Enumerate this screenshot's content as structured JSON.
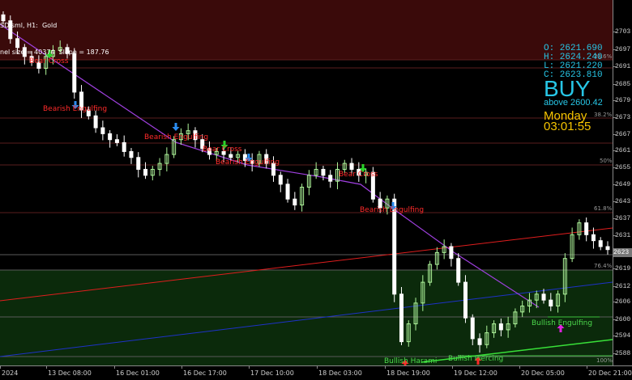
{
  "header": {
    "line1": "SD.sml, H1:  Gold",
    "line2": "nel size = 40374  Slope = 187.76"
  },
  "price_axis": {
    "ticks": [
      "2703",
      "2697",
      "2691",
      "2685",
      "2679",
      "2673",
      "2667",
      "2661",
      "2655",
      "2649",
      "2643",
      "2637",
      "2631",
      "2625",
      "2619",
      "2612",
      "2606",
      "2600",
      "2594",
      "2588"
    ],
    "current_price": "2623"
  },
  "time_axis": {
    "ticks": [
      "2024",
      "13 Dec 08:00",
      "16 Dec 01:00",
      "16 Dec 17:00",
      "17 Dec 10:00",
      "18 Dec 03:00",
      "18 Dec 19:00",
      "19 Dec 12:00",
      "20 Dec 05:00",
      "20 Dec 21:00"
    ]
  },
  "fib_levels": [
    "23.6%",
    "38.2%",
    "50%",
    "61.8%",
    "76.4%",
    "100%"
  ],
  "info_panel": {
    "open": "O: 2621.690",
    "high": "H: 2624.240",
    "low": "L: 2621.220",
    "close": "C: 2623.810",
    "signal": "BUY",
    "signal_sub": "above 2600.42",
    "day": "Monday",
    "clock": "03:01:55"
  },
  "patterns": [
    {
      "text": "Bear Cross",
      "color": "#ff2a2a",
      "arrow": "green-down"
    },
    {
      "text": "Bearish Engulfing",
      "color": "#ff2a2a",
      "arrow": "blue-down"
    },
    {
      "text": "Bearish Engulfing",
      "color": "#ff2a2a",
      "arrow": "blue-down"
    },
    {
      "text": "Bear Cross",
      "color": "#ff2a2a",
      "arrow": "green-down"
    },
    {
      "text": "Bearish Engulfing",
      "color": "#ff2a2a",
      "arrow": "blue-down"
    },
    {
      "text": "Bear Cross",
      "color": "#ff2a2a",
      "arrow": "green-down"
    },
    {
      "text": "Bearish Engulfing",
      "color": "#ff2a2a",
      "arrow": "blue-down"
    },
    {
      "text": "Bullish Harami",
      "color": "#4cd94c",
      "arrow": "red-up"
    },
    {
      "text": "Bullish Piercing",
      "color": "#4cd94c",
      "arrow": "red-up"
    },
    {
      "text": "Bullish Engulfing",
      "color": "#4cd94c",
      "arrow": "magenta-up"
    }
  ],
  "colors": {
    "supply_zone": "#3a0a0a",
    "demand_zone": "#0b2a0b",
    "bull_candle": "#aef59a",
    "bear_candle": "#ffffff",
    "downtrend": "#a040e0",
    "channel_upper": "#e01e1e",
    "channel_lower": "#1e32c8",
    "support_trend": "#38e038"
  },
  "chart_data": {
    "type": "candlestick",
    "symbol": "Gold",
    "timeframe": "H1",
    "ylim": [
      2584,
      2707
    ],
    "close_series_approx": [
      2700,
      2694,
      2691,
      2688,
      2686,
      2684,
      2688,
      2690,
      2691,
      2689,
      2676,
      2670,
      2668,
      2664,
      2662,
      2660,
      2659,
      2656,
      2654,
      2650,
      2648,
      2650,
      2652,
      2655,
      2660,
      2662,
      2663,
      2660,
      2657,
      2655,
      2656,
      2655,
      2654,
      2655,
      2653,
      2652,
      2655,
      2652,
      2648,
      2645,
      2640,
      2638,
      2644,
      2648,
      2650,
      2648,
      2646,
      2650,
      2652,
      2650,
      2648,
      2649,
      2640,
      2637,
      2640,
      2608,
      2592,
      2598,
      2605,
      2612,
      2618,
      2622,
      2624,
      2620,
      2612,
      2600,
      2593,
      2591,
      2595,
      2598,
      2596,
      2598,
      2602,
      2604,
      2606,
      2608,
      2606,
      2604,
      2608,
      2620,
      2628,
      2632,
      2628,
      2626,
      2624,
      2623
    ]
  }
}
